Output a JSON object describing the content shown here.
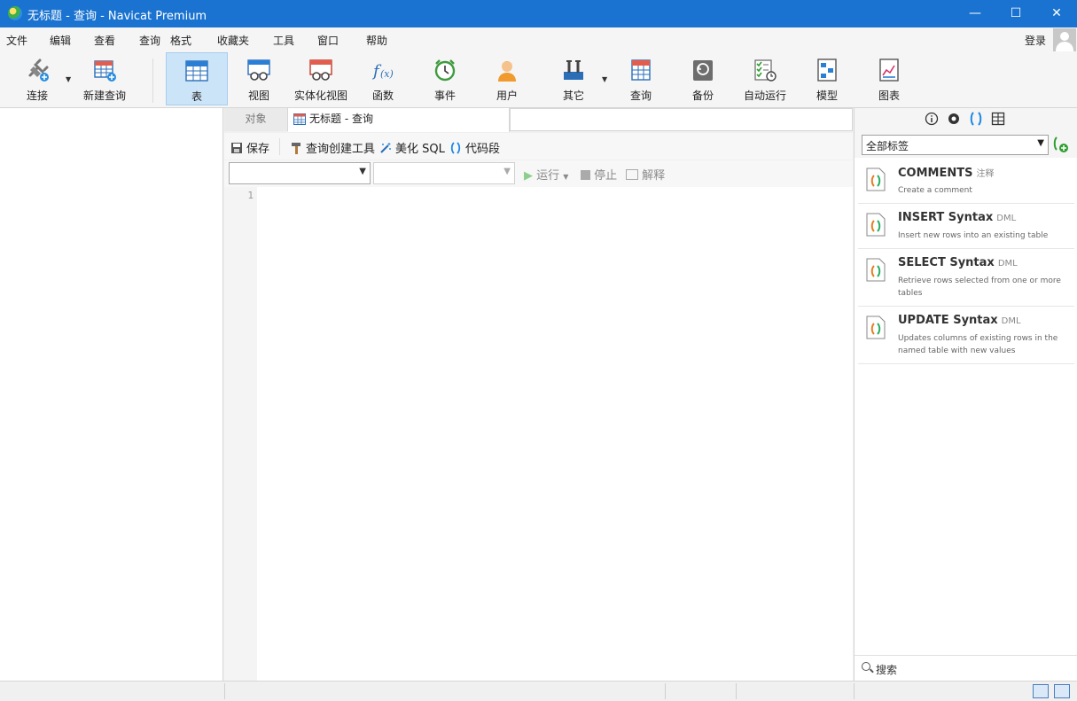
{
  "window": {
    "title": "无标题 - 查询 - Navicat Premium",
    "minimize": "—",
    "maximize": "☐",
    "close": "✕"
  },
  "menu": [
    "文件",
    "编辑",
    "查看",
    "查询",
    "格式",
    "收藏夹",
    "工具",
    "窗口",
    "帮助"
  ],
  "account": {
    "login": "登录"
  },
  "toolbar": {
    "connect": "连接",
    "new_query": "新建查询",
    "table": "表",
    "view": "视图",
    "materialized_view": "实体化视图",
    "function": "函数",
    "event": "事件",
    "user": "用户",
    "other": "其它",
    "query": "查询",
    "backup": "备份",
    "automation": "自动运行",
    "model": "模型",
    "chart": "图表"
  },
  "tabs": {
    "objects": "对象",
    "query": "无标题 - 查询"
  },
  "query_toolbar": {
    "save": "保存",
    "builder": "查询创建工具",
    "beautify": "美化 SQL",
    "snippet": "代码段"
  },
  "run_bar": {
    "run": "运行",
    "stop": "停止",
    "explain": "解释"
  },
  "editor": {
    "line_number": "1"
  },
  "snippets": {
    "filter": "全部标签",
    "items": [
      {
        "name": "COMMENTS",
        "tag": "注释",
        "desc": "Create a comment"
      },
      {
        "name": "INSERT Syntax",
        "tag": "DML",
        "desc": "Insert new rows into an existing table"
      },
      {
        "name": "SELECT Syntax",
        "tag": "DML",
        "desc": "Retrieve rows selected from one or more tables"
      },
      {
        "name": "UPDATE Syntax",
        "tag": "DML",
        "desc": "Updates columns of existing rows in the named table with new values"
      }
    ],
    "search": "搜索"
  },
  "colors": {
    "titlebar": "#1a73d0",
    "active_tool": "#cce4f7",
    "accent": "#1e88e5"
  }
}
